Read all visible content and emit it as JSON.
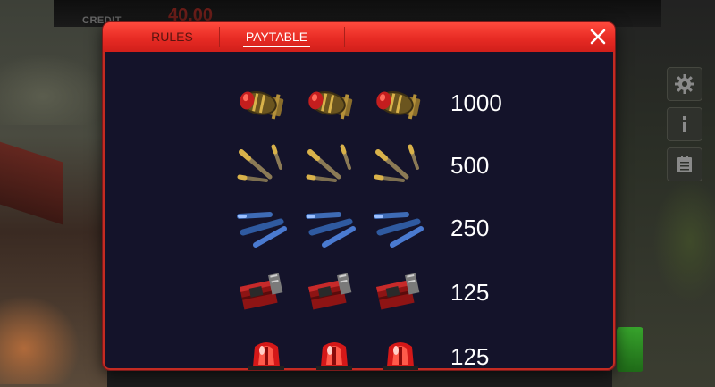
{
  "background": {
    "credit_label": "CREDIT",
    "credit_value": "40.00",
    "side_buttons": [
      {
        "icon": "gear-icon"
      },
      {
        "icon": "info-icon"
      },
      {
        "icon": "paytable-list-icon"
      }
    ]
  },
  "modal": {
    "tabs": [
      {
        "label": "RULES",
        "active": false
      },
      {
        "label": "PAYTABLE",
        "active": true
      }
    ],
    "close_icon": "close-icon",
    "header_color": "#e72b24",
    "body_color": "#14132a",
    "paytable": [
      {
        "symbol": "bomb",
        "count": 3,
        "payout": "1000"
      },
      {
        "symbol": "shells",
        "count": 3,
        "payout": "500"
      },
      {
        "symbol": "missiles",
        "count": 3,
        "payout": "250"
      },
      {
        "symbol": "dynamite",
        "count": 3,
        "payout": "125"
      },
      {
        "symbol": "siren",
        "count": 3,
        "payout": "125"
      }
    ]
  }
}
